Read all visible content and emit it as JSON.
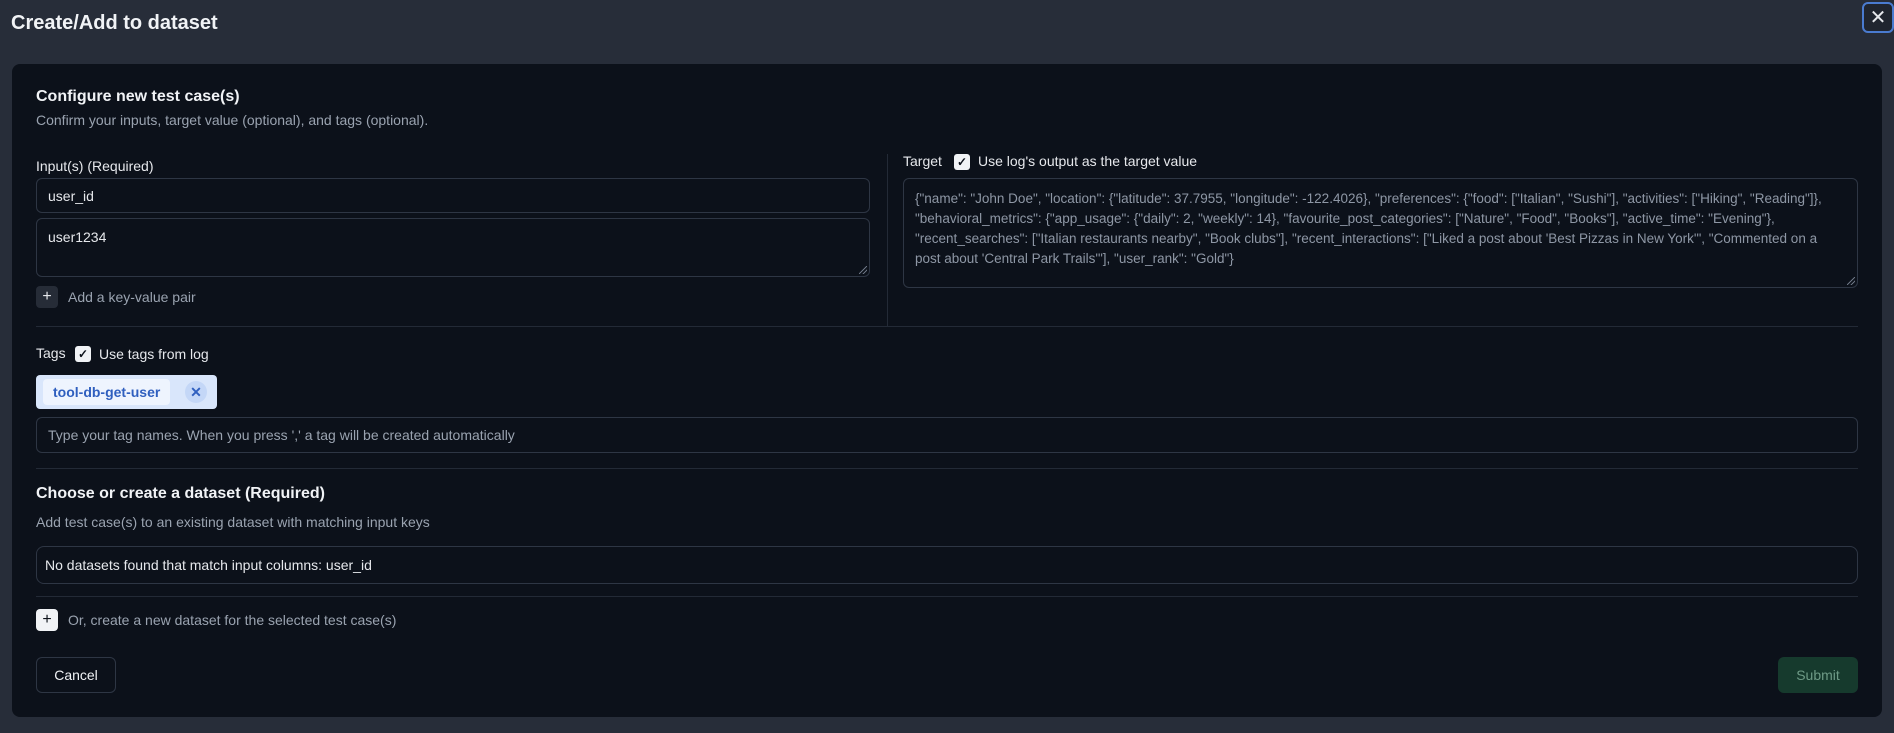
{
  "dialog": {
    "title": "Create/Add to dataset",
    "close_icon": "close-icon"
  },
  "configure": {
    "title": "Configure new test case(s)",
    "subtitle": "Confirm your inputs, target value (optional), and tags (optional)."
  },
  "inputs": {
    "label": "Input(s) (Required)",
    "key": "user_id",
    "value": "user1234",
    "add_pair_label": "Add a key-value pair"
  },
  "target": {
    "label": "Target",
    "checkbox_checked": true,
    "checkbox_label": "Use log's output as the target value",
    "value": "{\"name\": \"John Doe\", \"location\": {\"latitude\": 37.7955, \"longitude\": -122.4026}, \"preferences\": {\"food\": [\"Italian\", \"Sushi\"], \"activities\": [\"Hiking\", \"Reading\"]}, \"behavioral_metrics\": {\"app_usage\": {\"daily\": 2, \"weekly\": 14}, \"favourite_post_categories\": [\"Nature\", \"Food\", \"Books\"], \"active_time\": \"Evening\"}, \"recent_searches\": [\"Italian restaurants nearby\", \"Book clubs\"], \"recent_interactions\": [\"Liked a post about 'Best Pizzas in New York'\", \"Commented on a post about 'Central Park Trails'\"], \"user_rank\": \"Gold\"}"
  },
  "tags": {
    "label": "Tags",
    "checkbox_checked": true,
    "checkbox_label": "Use tags from log",
    "items": [
      "tool-db-get-user"
    ],
    "placeholder": "Type your tag names. When you press ',' a tag will be created automatically"
  },
  "dataset": {
    "title": "Choose or create a dataset (Required)",
    "subtitle": "Add test case(s) to an existing dataset with matching input keys",
    "select_value": "No datasets found that match input columns: user_id",
    "create_label": "Or, create a new dataset for the selected test case(s)"
  },
  "footer": {
    "cancel_label": "Cancel",
    "submit_label": "Submit"
  },
  "colors": {
    "background": "#272d39",
    "panel": "#0c111a",
    "tag_accent": "#2f5fbf",
    "submit_disabled": "#163a2d"
  }
}
